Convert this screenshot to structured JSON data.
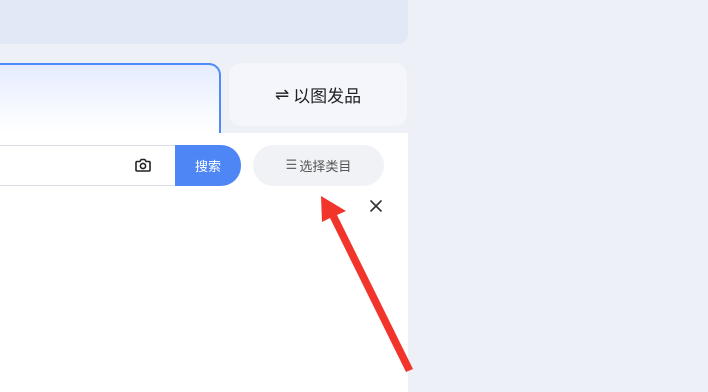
{
  "tabs": {
    "image_tab_label": "以图发品",
    "image_tab_icon": "swap-icon"
  },
  "search": {
    "placeholder": "",
    "value": "",
    "button_label": "搜索",
    "camera_icon": "camera-icon"
  },
  "category": {
    "button_label": "选择类目",
    "icon": "list-icon"
  },
  "dialog": {
    "close_icon": "close-icon"
  },
  "annotation": {
    "arrow_color": "#f2352b",
    "target": "category-button"
  },
  "colors": {
    "accent": "#4e86f5",
    "page_bg": "#eef0f8",
    "arrow": "#f2352b"
  }
}
